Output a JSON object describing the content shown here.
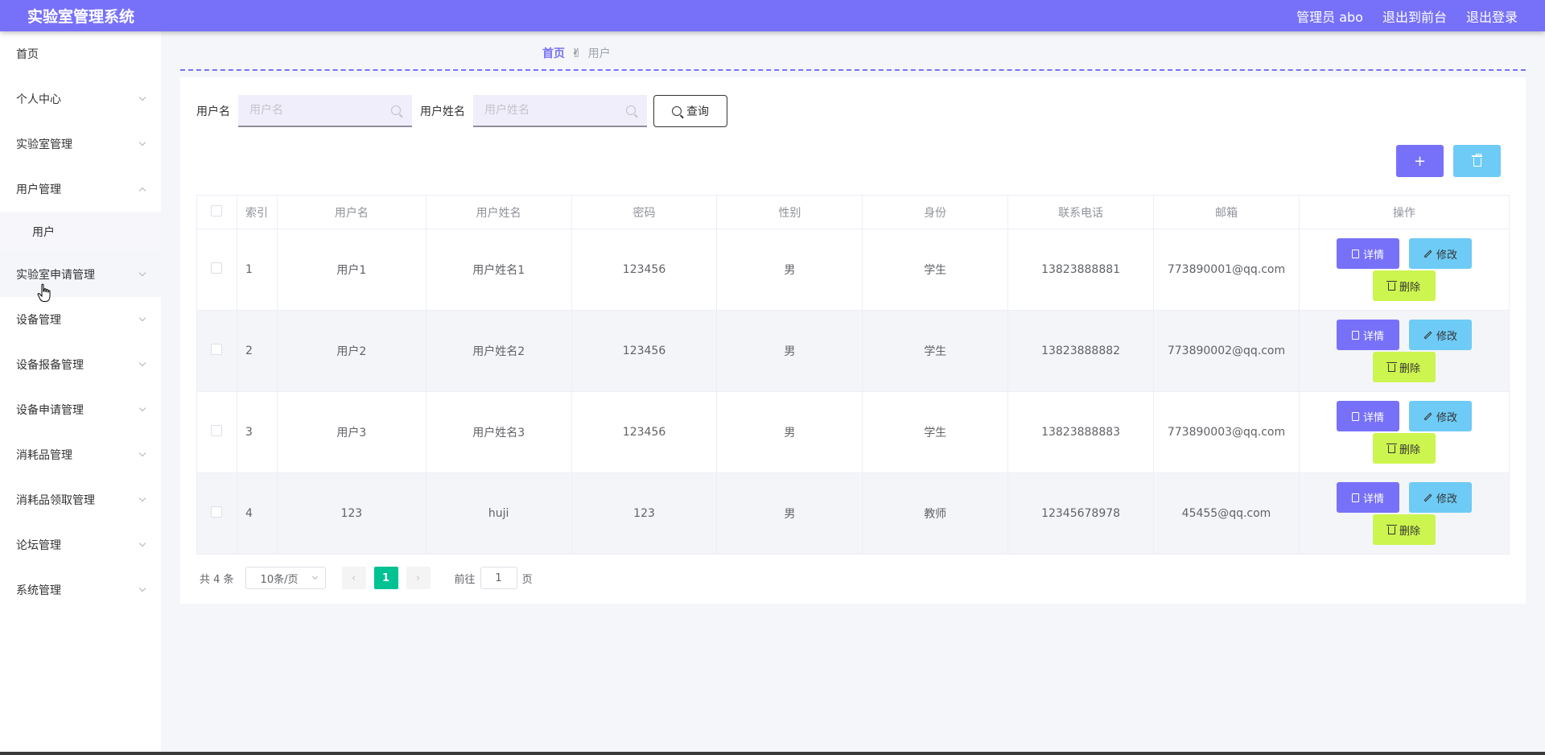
{
  "app": {
    "title": "实验室管理系统"
  },
  "header": {
    "user": "管理员 abo",
    "to_front": "退出到前台",
    "logout": "退出登录"
  },
  "sidebar": {
    "items": [
      {
        "label": "首页"
      },
      {
        "label": "个人中心"
      },
      {
        "label": "实验室管理"
      },
      {
        "label": "用户管理"
      },
      {
        "label": "实验室申请管理"
      },
      {
        "label": "设备管理"
      },
      {
        "label": "设备报备管理"
      },
      {
        "label": "设备申请管理"
      },
      {
        "label": "消耗品管理"
      },
      {
        "label": "消耗品领取管理"
      },
      {
        "label": "论坛管理"
      },
      {
        "label": "系统管理"
      }
    ],
    "sub_user": "用户"
  },
  "breadcrumb": {
    "home": "首页",
    "sep": "✌",
    "current": "用户"
  },
  "search": {
    "username_label": "用户名",
    "username_placeholder": "用户名",
    "realname_label": "用户姓名",
    "realname_placeholder": "用户姓名",
    "query_label": "查询"
  },
  "toolbar": {
    "add_label": "+"
  },
  "table": {
    "headers": [
      "索引",
      "用户名",
      "用户姓名",
      "密码",
      "性别",
      "身份",
      "联系电话",
      "邮箱",
      "操作"
    ],
    "rows": [
      {
        "index": "1",
        "username": "用户1",
        "realname": "用户姓名1",
        "password": "123456",
        "gender": "男",
        "role": "学生",
        "phone": "13823888881",
        "email": "773890001@qq.com"
      },
      {
        "index": "2",
        "username": "用户2",
        "realname": "用户姓名2",
        "password": "123456",
        "gender": "男",
        "role": "学生",
        "phone": "13823888882",
        "email": "773890002@qq.com"
      },
      {
        "index": "3",
        "username": "用户3",
        "realname": "用户姓名3",
        "password": "123456",
        "gender": "男",
        "role": "学生",
        "phone": "13823888883",
        "email": "773890003@qq.com"
      },
      {
        "index": "4",
        "username": "123",
        "realname": "huji",
        "password": "123",
        "gender": "男",
        "role": "教师",
        "phone": "12345678978",
        "email": "45455@qq.com"
      }
    ],
    "actions": {
      "detail": "详情",
      "edit": "修改",
      "delete": "删除"
    }
  },
  "pagination": {
    "total": "共 4 条",
    "page_size": "10条/页",
    "current_page": "1",
    "goto_label": "前往",
    "goto_value": "1",
    "page_suffix": "页"
  },
  "colors": {
    "accent": "#7771f9",
    "info": "#6ecbf5",
    "danger": "#cdf54f",
    "pager_active": "#00c292"
  }
}
